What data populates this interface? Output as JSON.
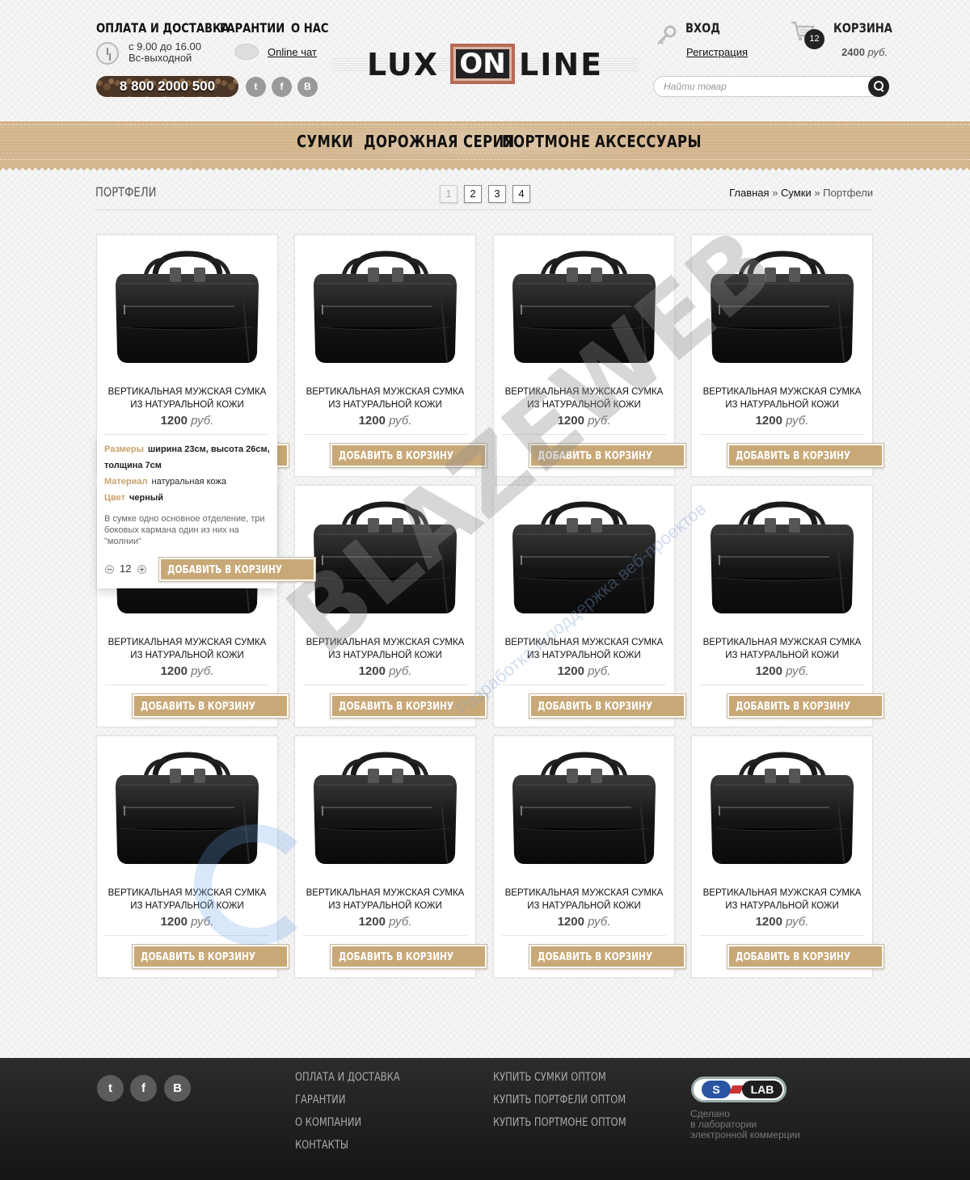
{
  "header": {
    "nav": [
      "ОПЛАТА И ДОСТАВКА",
      "ГАРАНТИИ",
      "О НАС"
    ],
    "hours_line1": "с 9.00 до 16.00",
    "hours_line2": "Вс-выходной",
    "chat": "Online чат",
    "phone": "8 800 2000 500",
    "social": [
      "twitter-icon",
      "facebook-icon",
      "vk-icon"
    ],
    "logo_left": "LUX",
    "logo_mid": "ON",
    "logo_right": "LINE",
    "login": "ВХОД",
    "register": "Регистрация",
    "cart_title": "КОРЗИНА",
    "cart_count": "12",
    "cart_sum": "2400",
    "cart_currency": "руб.",
    "search_placeholder": "Найти товар"
  },
  "categories": [
    "СУМКИ",
    "ДОРОЖНАЯ СЕРИЯ",
    "ПОРТМОНЕ",
    "АКСЕССУАРЫ"
  ],
  "page": {
    "title": "ПОРТФЕЛИ",
    "pages": [
      "1",
      "2",
      "3",
      "4"
    ],
    "current_page": "1",
    "breadcrumbs": [
      "Главная",
      "Сумки",
      "Портфели"
    ],
    "crumb_sep": "»"
  },
  "product_template": {
    "name_line1": "ВЕРТИКАЛЬНАЯ МУЖСКАЯ СУМКА",
    "name_line2": "ИЗ НАТУРАЛЬНОЙ КОЖИ",
    "price": "1200",
    "currency": "руб.",
    "button": "ДОБАВИТЬ В КОРЗИНУ"
  },
  "product_count": 12,
  "popup": {
    "sizes_label": "Размеры",
    "sizes_value1": "ширина 23см, высота 26см,",
    "sizes_value2": "толщина 7см",
    "material_label": "Материал",
    "material_value": "натуральная кожа",
    "color_label": "Цвет",
    "color_value": "черный",
    "description": "В сумке одно основное отделение, три боковых кармана один из них на \"молнии\"",
    "quantity": "12",
    "button": "ДОБАВИТЬ В КОРЗИНУ"
  },
  "watermark": {
    "main": "BLAZEWEB",
    "sub": "Разработка и поддержка веб-проектов"
  },
  "footer": {
    "col1": [
      "ОПЛАТА И ДОСТАВКА",
      "ГАРАНТИИ",
      "О КОМПАНИИ",
      "КОНТАКТЫ"
    ],
    "col2": [
      "КУПИТЬ СУМКИ ОПТОМ",
      "КУПИТЬ ПОРТФЕЛИ ОПТОМ",
      "КУПИТЬ ПОРТМОНЕ ОПТОМ"
    ],
    "logo_s": "S",
    "logo_lab": "LAB",
    "made1": "Сделано",
    "made2": "в лаборатории",
    "made3": "электронной коммерции"
  },
  "colors": {
    "accent": "#c9a877",
    "category_bar": "#d2b48c",
    "footer": "#1e1e1e"
  }
}
